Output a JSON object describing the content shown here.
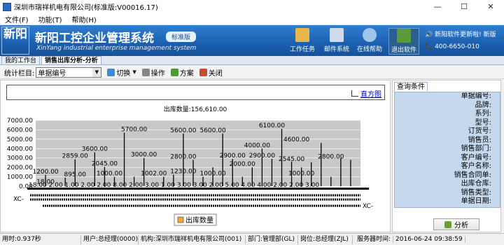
{
  "window": {
    "title": "深圳市瑞祥机电有限公司(标准版:V00016.17)",
    "minimize": "—",
    "maximize": "☐",
    "close": "✕"
  },
  "menu": {
    "items": [
      "文件(F)",
      "功能(T)",
      "帮助(H)"
    ]
  },
  "banner": {
    "logo_text": "新阳",
    "title": "新阳工控企业管理系统",
    "edition": "标准版",
    "subtitle": "XinYang industrial enterprise management system",
    "tools": [
      {
        "label": "工作任务",
        "icon": "folder-person-icon",
        "color": "#e8b64a"
      },
      {
        "label": "邮件系统",
        "icon": "envelope-icon",
        "color": "#cfdcec"
      },
      {
        "label": "在线帮助",
        "icon": "help-globe-icon",
        "color": "#9ec6ea"
      },
      {
        "label": "退出软件",
        "icon": "exit-door-icon",
        "color": "#5a9a3a"
      }
    ],
    "news_text": "新阳软件更新啦! 新版",
    "phone": "400-6650-010"
  },
  "tabs": [
    {
      "label": "我的工作台"
    },
    {
      "label": "销售出库分析-分析"
    }
  ],
  "toolbar": {
    "column_label": "统计栏目:",
    "column_value": "单据编号",
    "switch_label": "切换",
    "operate_label": "操作",
    "scheme_label": "方案",
    "close_label": "关闭"
  },
  "report": {
    "histogram_link": "直方图"
  },
  "chart_data": {
    "type": "bar",
    "title": "出库数量:156,610.00",
    "ylim": [
      0,
      7000
    ],
    "yticks": [
      "0.00",
      "1000.00",
      "2000.00",
      "3000.00",
      "4000.00",
      "5000.00",
      "6000.00",
      "7000.00"
    ],
    "series": [
      {
        "name": "出库数量",
        "color": "#f7a838",
        "values": [
          1200,
          18,
          895,
          2859,
          2,
          3600,
          2045,
          1000,
          5700,
          1002,
          3000,
          8,
          1000,
          1230,
          5600,
          2800,
          1000,
          2000,
          5600,
          2900,
          1000,
          2000,
          4000,
          2900,
          6100,
          2600,
          2000,
          2545,
          4600,
          1000,
          3000,
          2800
        ]
      }
    ],
    "data_labels": [
      {
        "text": "1200.00",
        "x": 1,
        "y": 1200
      },
      {
        "text": "18.00",
        "x": 1,
        "y": 120
      },
      {
        "text": "2859.00",
        "x": 4,
        "y": 2859
      },
      {
        "text": "895.00",
        "x": 4,
        "y": 895
      },
      {
        "text": "3600.00",
        "x": 6,
        "y": 3600
      },
      {
        "text": "2045.00",
        "x": 7,
        "y": 2045
      },
      {
        "text": "1000.00",
        "x": 7.5,
        "y": 1000
      },
      {
        "text": "5700.00",
        "x": 10,
        "y": 5700
      },
      {
        "text": "3000.00",
        "x": 11,
        "y": 3000
      },
      {
        "text": "1002.00",
        "x": 12,
        "y": 1002
      },
      {
        "text": "1230.00",
        "x": 15,
        "y": 1230
      },
      {
        "text": "5600.00",
        "x": 15,
        "y": 5600
      },
      {
        "text": "2800.00",
        "x": 15,
        "y": 2800
      },
      {
        "text": "5600.00",
        "x": 18,
        "y": 5600
      },
      {
        "text": "1000.00",
        "x": 18,
        "y": 1000
      },
      {
        "text": "2900.00",
        "x": 20,
        "y": 2900
      },
      {
        "text": "2000.00",
        "x": 21,
        "y": 2000
      },
      {
        "text": "4000.00",
        "x": 22.5,
        "y": 4000
      },
      {
        "text": "6100.00",
        "x": 24,
        "y": 6100
      },
      {
        "text": "2900.00",
        "x": 23,
        "y": 2900
      },
      {
        "text": "4600.00",
        "x": 26.5,
        "y": 4600
      },
      {
        "text": "2545.00",
        "x": 26,
        "y": 2545
      },
      {
        "text": "1000.00",
        "x": 27,
        "y": 1000
      },
      {
        "text": "2800.00",
        "x": 30,
        "y": 2800
      }
    ],
    "x_tick_text": "18.00  2.00  1.00  2.00  2.00  8.00  2.00  3.00  1.00  3.00  3.00  2.00  5.00  4.00  4.00  2.00  2.00  3.00",
    "x_category_prefix": "XC-",
    "legend": "出库数量",
    "legend_position": "bottom"
  },
  "query": {
    "tab_label": "查询条件",
    "fields": [
      "单据编号:",
      "品牌:",
      "系列:",
      "型号:",
      "订货号:",
      "销售员:",
      "销售部门:",
      "客户编号:",
      "客户名称:",
      "销售合同单:",
      "出库仓库:",
      "销售类型:",
      "单据日期:"
    ],
    "button_label": "分析"
  },
  "status": {
    "elapsed": "用时:0.937秒",
    "user": "用户:总经理(0000)",
    "org": "机构:深圳市瑞祥机电有限公司(001)",
    "dept": "部门:管理部(GL)",
    "post": "岗位:总经理(ZJL)",
    "server_time_label": "服务器时间:",
    "server_time": "2016-06-24  09:38:59"
  }
}
